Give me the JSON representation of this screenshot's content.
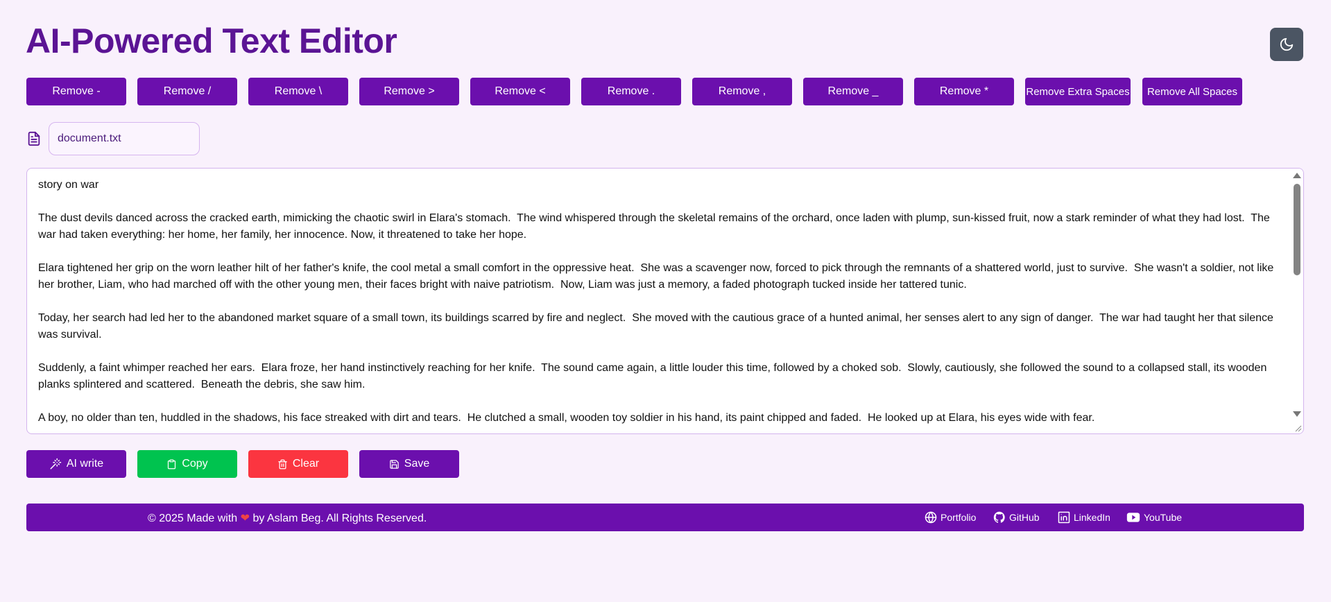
{
  "app": {
    "title": "AI-Powered Text Editor",
    "theme_toggle_icon": "moon-icon"
  },
  "toolbar": {
    "buttons": [
      "Remove -",
      "Remove /",
      "Remove \\",
      "Remove >",
      "Remove <",
      "Remove .",
      "Remove ,",
      "Remove _",
      "Remove *",
      "Remove Extra Spaces",
      "Remove All Spaces"
    ]
  },
  "file": {
    "icon": "document-icon",
    "name": "document.txt"
  },
  "editor": {
    "content": "story on war\n\nThe dust devils danced across the cracked earth, mimicking the chaotic swirl in Elara's stomach.  The wind whispered through the skeletal remains of the orchard, once laden with plump, sun-kissed fruit, now a stark reminder of what they had lost.  The war had taken everything: her home, her family, her innocence. Now, it threatened to take her hope.\n\nElara tightened her grip on the worn leather hilt of her father's knife, the cool metal a small comfort in the oppressive heat.  She was a scavenger now, forced to pick through the remnants of a shattered world, just to survive.  She wasn't a soldier, not like her brother, Liam, who had marched off with the other young men, their faces bright with naive patriotism.  Now, Liam was just a memory, a faded photograph tucked inside her tattered tunic.\n\nToday, her search had led her to the abandoned market square of a small town, its buildings scarred by fire and neglect.  She moved with the cautious grace of a hunted animal, her senses alert to any sign of danger.  The war had taught her that silence was survival.\n\nSuddenly, a faint whimper reached her ears.  Elara froze, her hand instinctively reaching for her knife.  The sound came again, a little louder this time, followed by a choked sob.  Slowly, cautiously, she followed the sound to a collapsed stall, its wooden planks splintered and scattered.  Beneath the debris, she saw him.\n\nA boy, no older than ten, huddled in the shadows, his face streaked with dirt and tears.  He clutched a small, wooden toy soldier in his hand, its paint chipped and faded.  He looked up at Elara, his eyes wide with fear."
  },
  "actions": {
    "ai_write": "AI write",
    "copy": "Copy",
    "clear": "Clear",
    "save": "Save"
  },
  "colors": {
    "primary": "#6b0fad",
    "copy": "#00c34f",
    "clear": "#fb3540",
    "background": "#f9f1fc",
    "title": "#5b1494"
  },
  "footer": {
    "copyright_prefix": "© 2025 Made with",
    "heart": "❤",
    "copyright_suffix": "by Aslam Beg. All Rights Reserved.",
    "links": [
      "Portfolio",
      "GitHub",
      "LinkedIn",
      "YouTube"
    ]
  }
}
